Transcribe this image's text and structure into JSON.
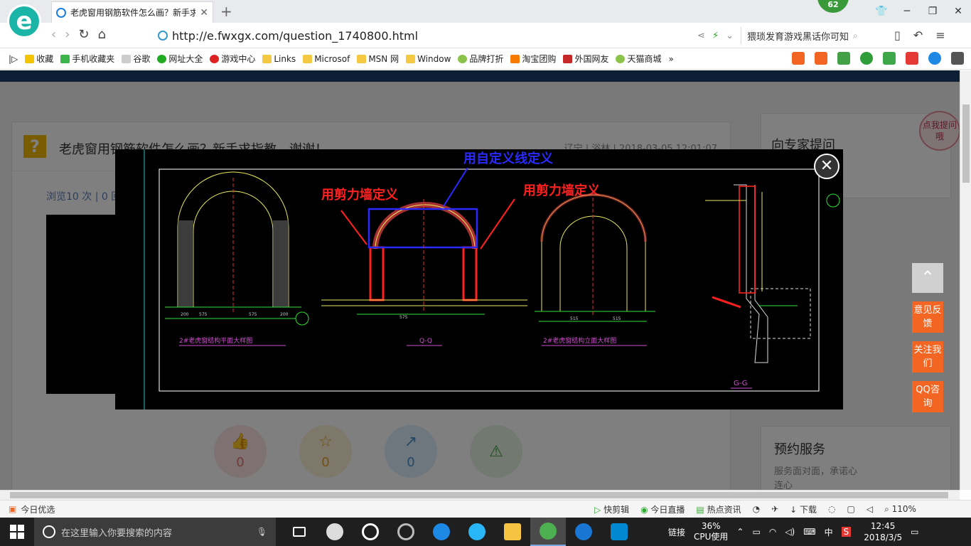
{
  "browser": {
    "tab_title": "老虎窗用钢筋软件怎么画？新手求",
    "badge": "62",
    "url": "http://e.fwxgx.com/question_1740800.html",
    "search_text": "猥琐发育游戏黑话你可知"
  },
  "bookmarks": [
    "收藏",
    "手机收藏夹",
    "谷歌",
    "网址大全",
    "游戏中心",
    "Links",
    "Microsof",
    "MSN 网",
    "Window",
    "品牌打折",
    "淘宝团购",
    "外国网友",
    "天猫商城"
  ],
  "question": {
    "title": "老虎窗用钢筋软件怎么画？新手求指教，谢谢！",
    "meta": "辽宁 | 浴林 | 2018-03-05 12:01:07",
    "stats": "浏览10 次 | 0 回",
    "counts": [
      "0",
      "0",
      "0"
    ]
  },
  "sidebar": {
    "expert_title": "向专家提问",
    "bubble": "点我提问哦",
    "service_title": "预约服务",
    "service_desc": "服务面对面，承诺心连心"
  },
  "float_buttons": [
    "意见反馈",
    "关注我们",
    "QQ咨询"
  ],
  "drawing": {
    "annotation_blue": "用自定义线定义",
    "annotation_red_left": "用剪力墙定义",
    "annotation_red_right": "用剪力墙定义",
    "label_front": "2#老虎窗结构平面大样图",
    "label_qq": "Q-Q",
    "label_side": "2#老虎窗结构立面大样图",
    "label_gg": "G-G",
    "dims": [
      "575",
      "575",
      "575",
      "515",
      "515",
      "200",
      "200"
    ]
  },
  "statusbar": {
    "left": "今日优选",
    "items": [
      "快剪辑",
      "今日直播",
      "热点资讯",
      "下载"
    ],
    "zoom": "110%"
  },
  "taskbar": {
    "search_placeholder": "在这里输入你要搜索的内容",
    "link_label": "链接",
    "cpu_percent": "36%",
    "cpu_label": "CPU使用",
    "ime": "中",
    "time": "12:45",
    "date": "2018/3/5"
  },
  "colors": {
    "accent_orange": "#f26522",
    "cad_red": "#ff2020",
    "cad_blue": "#2a2aff",
    "cad_yellow": "#e8e860",
    "cad_green": "#30e030"
  }
}
